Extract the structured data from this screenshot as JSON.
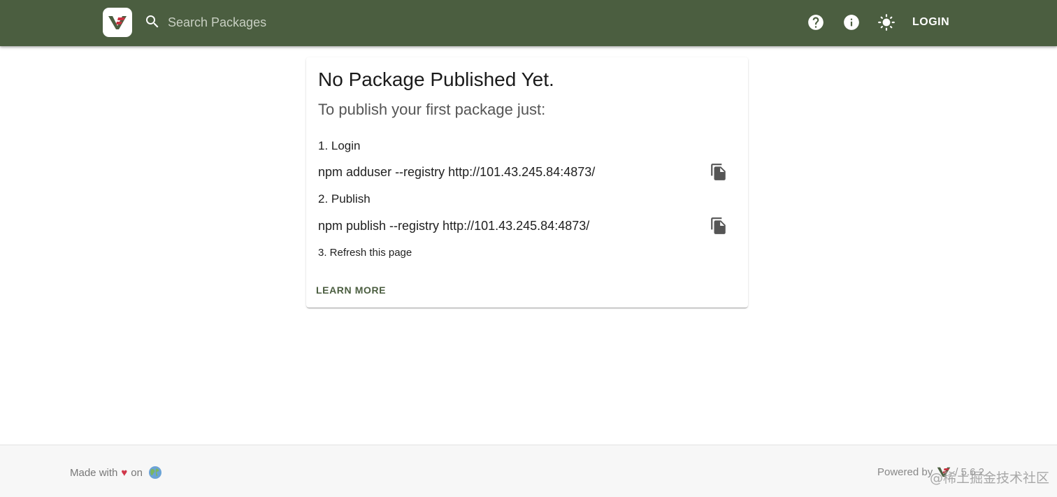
{
  "header": {
    "search_placeholder": "Search Packages",
    "login_label": "LOGIN",
    "icons": [
      "logo",
      "search-icon",
      "help-icon",
      "info-icon",
      "theme-toggle-icon"
    ]
  },
  "card": {
    "title": "No Package Published Yet.",
    "subtitle": "To publish your first package just:",
    "steps": [
      {
        "label": "1. Login",
        "command": "npm adduser --registry http://101.43.245.84:4873/"
      },
      {
        "label": "2. Publish",
        "command": "npm publish --registry http://101.43.245.84:4873/"
      },
      {
        "label": "3. Refresh this page"
      }
    ],
    "learn_more_label": "LEARN MORE"
  },
  "footer": {
    "made_with": "Made with",
    "heart": "♥",
    "on": "on",
    "powered_by": "Powered by",
    "version": "/ 5.6.2",
    "watermark": "@稀土掘金技术社区"
  },
  "colors": {
    "header_bg": "#4b5e40",
    "accent": "#4b5e40",
    "logo_red": "#c8313f",
    "heart": "#d0374a"
  }
}
